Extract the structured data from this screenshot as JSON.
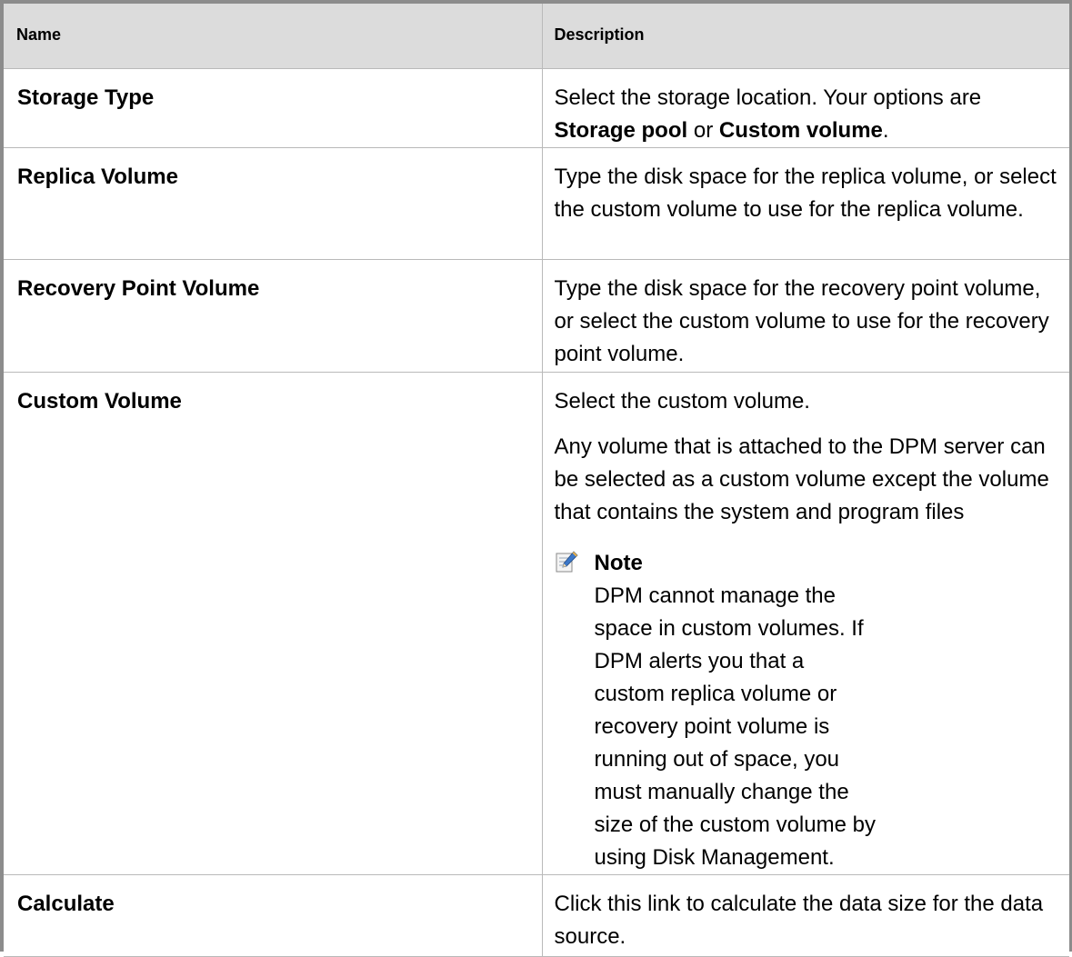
{
  "table": {
    "headers": {
      "name": "Name",
      "description": "Description"
    },
    "rows": [
      {
        "name": "Storage Type",
        "description": {
          "text_before": "Select the storage location. Your options are ",
          "bold_1": "Storage pool",
          "text_middle": " or ",
          "bold_2": "Custom volume",
          "text_after": "."
        }
      },
      {
        "name": "Replica Volume",
        "description": "Type the disk space for the replica volume, or select the custom volume to use for the replica volume."
      },
      {
        "name": "Recovery Point Volume",
        "description": "Type the disk space for the recovery point volume, or select the custom volume to use for the recovery point volume."
      },
      {
        "name": "Custom Volume",
        "description_1": "Select the custom volume.",
        "description_2": "Any volume that is attached to the DPM server can be selected as a custom volume except the volume that contains the system and program files",
        "note": {
          "icon": "note-pencil-icon",
          "title": "Note",
          "text": "DPM cannot manage the space in custom volumes. If DPM alerts you that a custom replica volume or recovery point volume is running out of space, you must manually change the size of the custom volume by using Disk Management."
        }
      },
      {
        "name": "Calculate",
        "description": "Click this link to calculate the data size for the data source."
      }
    ]
  },
  "colors": {
    "header_bg": "#dcdcdc",
    "border": "#b9b9b9",
    "frame": "#8c8c8c"
  }
}
